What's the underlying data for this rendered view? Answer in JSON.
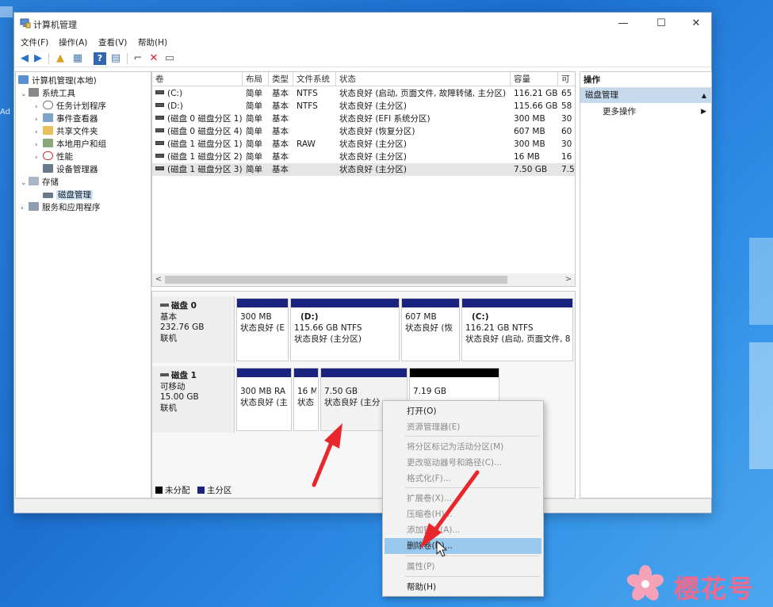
{
  "desktop": {
    "left_text": "Ad"
  },
  "window": {
    "title": "计算机管理",
    "controls": {
      "minimize": "—",
      "maximize": "☐",
      "close": "✕"
    },
    "menu": [
      "文件(F)",
      "操作(A)",
      "查看(V)",
      "帮助(H)"
    ]
  },
  "tree": {
    "root": "计算机管理(本地)",
    "system_tools": "系统工具",
    "task_scheduler": "任务计划程序",
    "event_viewer": "事件查看器",
    "shared_folders": "共享文件夹",
    "local_users": "本地用户和组",
    "performance": "性能",
    "device_manager": "设备管理器",
    "storage": "存储",
    "disk_management": "磁盘管理",
    "services_apps": "服务和应用程序"
  },
  "volumes": {
    "headers": [
      "卷",
      "布局",
      "类型",
      "文件系统",
      "状态",
      "容量",
      "可"
    ],
    "rows": [
      [
        "(C:)",
        "简单",
        "基本",
        "NTFS",
        "状态良好 (启动, 页面文件, 故障转储, 主分区)",
        "116.21 GB",
        "65"
      ],
      [
        "(D:)",
        "简单",
        "基本",
        "NTFS",
        "状态良好 (主分区)",
        "115.66 GB",
        "58"
      ],
      [
        "(磁盘 0 磁盘分区 1)",
        "简单",
        "基本",
        "",
        "状态良好 (EFI 系统分区)",
        "300 MB",
        "30"
      ],
      [
        "(磁盘 0 磁盘分区 4)",
        "简单",
        "基本",
        "",
        "状态良好 (恢复分区)",
        "607 MB",
        "60"
      ],
      [
        "(磁盘 1 磁盘分区 1)",
        "简单",
        "基本",
        "RAW",
        "状态良好 (主分区)",
        "300 MB",
        "30"
      ],
      [
        "(磁盘 1 磁盘分区 2)",
        "简单",
        "基本",
        "",
        "状态良好 (主分区)",
        "16 MB",
        "16"
      ],
      [
        "(磁盘 1 磁盘分区 3)",
        "简单",
        "基本",
        "",
        "状态良好 (主分区)",
        "7.50 GB",
        "7.5"
      ]
    ],
    "scroll_left": "<",
    "scroll_right": ">"
  },
  "disks": {
    "disk0": {
      "name": "磁盘 0",
      "type": "基本",
      "size": "232.76 GB",
      "status": "联机",
      "parts": [
        {
          "name": "",
          "size": "300 MB",
          "status": "状态良好 (E"
        },
        {
          "name": "(D:)",
          "size": "115.66 GB NTFS",
          "status": "状态良好 (主分区)"
        },
        {
          "name": "",
          "size": "607 MB",
          "status": "状态良好 (恢"
        },
        {
          "name": "(C:)",
          "size": "116.21 GB NTFS",
          "status": "状态良好 (启动, 页面文件, 8"
        }
      ]
    },
    "disk1": {
      "name": "磁盘 1",
      "type": "可移动",
      "size": "15.00 GB",
      "status": "联机",
      "parts": [
        {
          "size": "300 MB RA",
          "status": "状态良好 (主"
        },
        {
          "size": "16 M",
          "status": "状态"
        },
        {
          "size": "7.50 GB",
          "status": "状态良好 (主分"
        },
        {
          "size": "7.19 GB",
          "status": ""
        }
      ]
    },
    "legend": {
      "unallocated": "未分配",
      "primary": "主分区"
    }
  },
  "actions": {
    "title": "操作",
    "section": "磁盘管理",
    "more": "更多操作"
  },
  "context_menu": {
    "items": [
      {
        "label": "打开(O)",
        "disabled": false
      },
      {
        "label": "资源管理器(E)",
        "disabled": true
      },
      {
        "label": "将分区标记为活动分区(M)",
        "disabled": true
      },
      {
        "label": "更改驱动器号和路径(C)...",
        "disabled": true
      },
      {
        "label": "格式化(F)...",
        "disabled": true
      },
      {
        "label": "扩展卷(X)...",
        "disabled": true
      },
      {
        "label": "压缩卷(H)...",
        "disabled": true
      },
      {
        "label": "添加镜像(A)...",
        "disabled": true
      },
      {
        "label": "删除卷(D)...",
        "disabled": false,
        "highlighted": true
      },
      {
        "label": "属性(P)",
        "disabled": true
      },
      {
        "label": "帮助(H)",
        "disabled": false
      }
    ]
  },
  "watermark": {
    "text": "樱花号"
  },
  "colors": {
    "primary_partition": "#1a237e",
    "unallocated": "#000000",
    "menu_highlight": "#99c9ef",
    "annotation_arrow": "#e8262b",
    "watermark": "#f06a8e"
  }
}
